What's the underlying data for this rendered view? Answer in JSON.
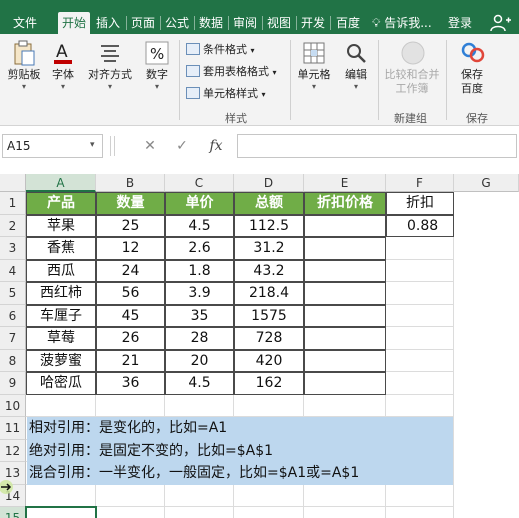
{
  "tabs": [
    "文件",
    "开始",
    "插入",
    "页面",
    "公式",
    "数据",
    "审阅",
    "视图",
    "开发",
    "百度"
  ],
  "active_tab": "开始",
  "tell_me": "告诉我...",
  "login": "登录",
  "share_icon": "person-plus-icon",
  "ribbon": {
    "clipboard": "剪贴板",
    "font": "字体",
    "alignment": "对齐方式",
    "number": "数字",
    "conditional_format": "条件格式",
    "table_format": "套用表格格式",
    "cell_style": "单元格样式",
    "styles_group": "样式",
    "cells": "单元格",
    "editing": "编辑",
    "compare_merge_1": "比较和合并",
    "compare_merge_2": "工作簿",
    "new_group": "新建组",
    "save_to_1": "保存",
    "save_to_2": "百度",
    "save_group": "保存"
  },
  "formula_bar": {
    "name_box": "A15",
    "cancel": "✕",
    "confirm": "✓",
    "fx": "fx",
    "formula": ""
  },
  "columns": [
    "A",
    "B",
    "C",
    "D",
    "E",
    "F",
    "G"
  ],
  "selected_column": "A",
  "rows": [
    "1",
    "2",
    "3",
    "4",
    "5",
    "6",
    "7",
    "8",
    "9",
    "10",
    "11",
    "12",
    "13",
    "14",
    "15"
  ],
  "table": {
    "headers": [
      "产品",
      "数量",
      "单价",
      "总额",
      "折扣价格"
    ],
    "data": [
      [
        "苹果",
        "25",
        "4.5",
        "112.5",
        ""
      ],
      [
        "香蕉",
        "12",
        "2.6",
        "31.2",
        ""
      ],
      [
        "西瓜",
        "24",
        "1.8",
        "43.2",
        ""
      ],
      [
        "西红柿",
        "56",
        "3.9",
        "218.4",
        ""
      ],
      [
        "车厘子",
        "45",
        "35",
        "1575",
        ""
      ],
      [
        "草莓",
        "26",
        "28",
        "728",
        ""
      ],
      [
        "菠萝蜜",
        "21",
        "20",
        "420",
        ""
      ],
      [
        "哈密瓜",
        "36",
        "4.5",
        "162",
        ""
      ]
    ]
  },
  "discount": {
    "label": "折扣",
    "value": "0.88"
  },
  "notes": [
    "相对引用：是变化的，比如=A1",
    "绝对引用：是固定不变的，比如=$A$1",
    "混合引用：一半变化，一般固定，比如=$A1或=A$1"
  ],
  "colors": {
    "excel_green": "#217346",
    "header_green": "#70ad47",
    "note_blue": "#bdd7ee"
  }
}
